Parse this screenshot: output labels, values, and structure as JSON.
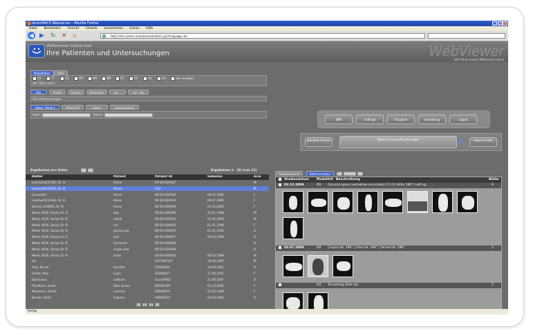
{
  "browser": {
    "title": "dicomPACS Webserver - Mozilla Firefox",
    "menu": [
      "Datei",
      "Bearbeiten",
      "Ansicht",
      "Chronik",
      "Lesezeichen",
      "Extras",
      "Hilfe"
    ],
    "url": "http://dsl1.oehm.com/dicom/s/index1.jsp?language=de",
    "status": "Fertig"
  },
  "header": {
    "welcome": "Willkommen Demo User",
    "title": "Ihre Patienten und Untersuchungen",
    "brand": "WebViewer",
    "brand_sub": "Hilfe Ohne unsere Webserver Lizenz"
  },
  "left": {
    "tabs": [
      "Modalitäten",
      "Filter"
    ],
    "modalities": [
      "CR",
      "CT",
      "DX",
      "MG",
      "MR",
      "NM",
      "OT",
      "RF",
      "US",
      "XA",
      "alle anzeigen"
    ],
    "filter_label": "akt. Filter: keine",
    "date_tabs": [
      "Alle",
      "Heute",
      "Gestern",
      "Zeitfenster",
      "am...",
      "von - bis"
    ],
    "date_label": "Alle Untersuchungen",
    "search_tabs": [
      "Halter, Patient",
      "Patient ID",
      "Halter",
      "Geburtsdatum"
    ],
    "search_halter": "Halter",
    "search_patient": "Patient",
    "results_per_page": "Ergebnisse pro Seite:",
    "results_range": "Ergebnisse 1 - 20 (von 21)",
    "columns": [
      "Halter",
      "Patient",
      "Patient ID",
      "Geboren",
      "m/w"
    ],
    "rows": [
      [
        "Leonhardt(3138), Dr.-R.",
        "Horse",
        "DR-EX-000087",
        "",
        "M"
      ],
      [
        "Leonhardt(3152), Dr.-R.",
        "Horse",
        "123",
        "",
        "M"
      ],
      [
        "Cavendish",
        "Horse",
        "DR-EX-000085",
        "09.07.2000",
        "F"
      ],
      [
        "Leonhardt(3138), Dr.-R.",
        "Horse",
        "DR-EX-000034",
        "09.07.2000",
        "F"
      ],
      [
        "Decaro CR3801, Dr.-R.",
        "Horse",
        "DR-EX-000084",
        "01.01.2003",
        "F"
      ],
      [
        "Medic 4030, Varian Dr.-R.",
        "dog",
        "DR-EX-000090",
        "25.01.1998",
        "M"
      ],
      [
        "Medic 4030, Varian Dr.-R.",
        "rabbit",
        "DR-EX-000030",
        "01.01.2000",
        "M"
      ],
      [
        "Medic 4030, Varian Dr.-R.",
        "cat",
        "DR-EX-000093",
        "01.01.1998",
        "F"
      ],
      [
        "Medic 4030, Varian Dr.-R.",
        "guinea pig",
        "DR-EX-000095",
        "01.01.2004",
        "O"
      ],
      [
        "Medic 4030, Varian Dr.-R.",
        "bird",
        "DR-EX-000097",
        "06.02.1999",
        "O"
      ],
      [
        "Medic 4030, Varian Dr.-R.",
        "Eichhorst",
        "DR-EX-000080",
        "",
        "O"
      ],
      [
        "Medic 4030, Varian Dr.-R.",
        "single wolf",
        "DR-EX-000089",
        "",
        "O"
      ],
      [
        "Medic 4030, Varian Dr.-R.",
        "turtle",
        "DR-EX-000050",
        "06.02.1998",
        "M"
      ],
      [
        "UA",
        "",
        "OHTUNY107",
        "18.05.2005",
        "M"
      ],
      [
        "Holz, Bernd",
        "Dorothe",
        "UR000034",
        "13.09.2002",
        "O"
      ],
      [
        "Scholl, Alex",
        "Luise",
        "GR000437",
        "17.06.2001",
        "F"
      ],
      [
        "Dulumann",
        "Leithaler",
        "Scan00002",
        "22.09.2007",
        "O"
      ],
      [
        "Pferdham, Heike",
        "Rote Sonne",
        "DR000256",
        "01.12.2002",
        "F"
      ],
      [
        "Neumann, Dieter",
        "Luzerne",
        "UR000679",
        "01.05.1999",
        "F"
      ],
      [
        "Becker, Heidi",
        "Argelna",
        "UR000614",
        "04.04.2003",
        "O"
      ]
    ],
    "pages": [
      "«",
      "1",
      "2",
      "»"
    ]
  },
  "right": {
    "top_buttons": [
      "EMR",
      "Aufträge",
      "Freigaben",
      "Verwaltung",
      "Logout"
    ],
    "open_current": "aktuelles Fenster",
    "open_images": "Bilder in neuem Fenster laden",
    "open_new": "neues Fenster",
    "tabs": [
      "Tabellenansicht",
      "Bildervorschau"
    ],
    "columns": [
      "Studiendatum",
      "Modalität",
      "Beschreibung",
      "Bilder"
    ],
    "studies": [
      {
        "date": "03.12.2009",
        "modality": "DX",
        "description": "Carvical spine (vertebrae cervicales) C1-C4 (Hilfe 190°) Left ng",
        "images": "9"
      },
      {
        "date": "03.07.2008",
        "modality": "DX",
        "description": "Carpus lat. 190° | Ulna lat. 190° | Tarsus lat. 190°",
        "images": "3"
      },
      {
        "date": "",
        "modality": "DX",
        "description": "Trocanting Zehe lat.",
        "images": "2"
      }
    ]
  },
  "colors": {
    "accent": "#4566c8",
    "header": "#6c6c6c",
    "selected_row": "#5f7fd8"
  }
}
